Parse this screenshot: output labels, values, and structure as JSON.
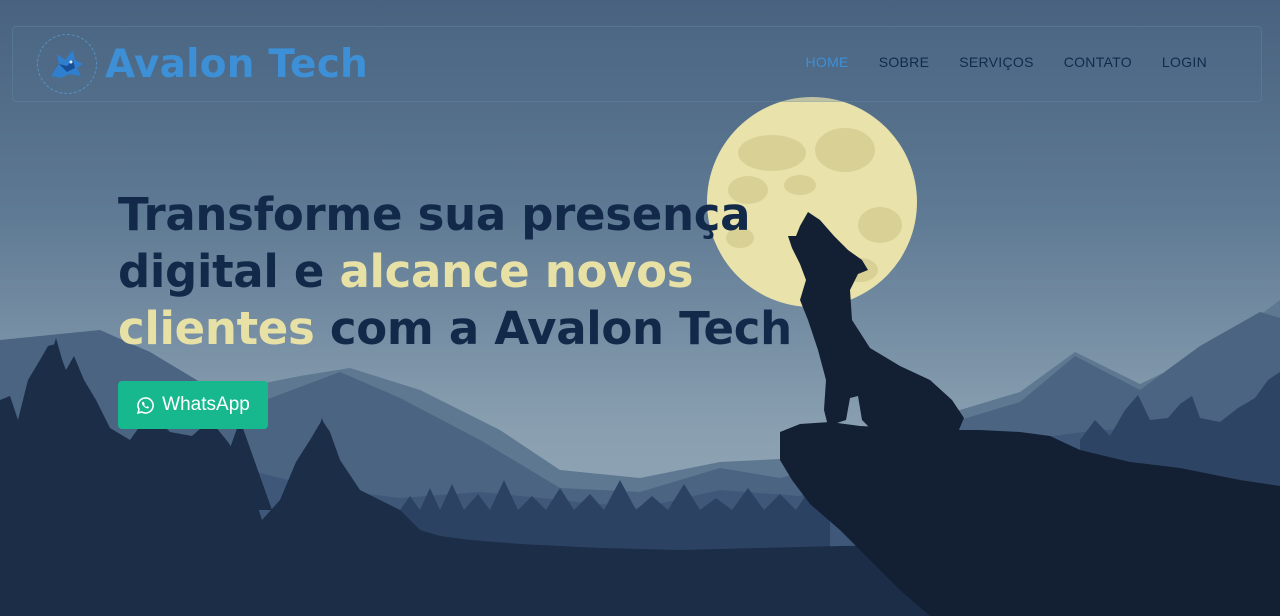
{
  "brand": {
    "name": "Avalon Tech",
    "logo_icon": "wolf-logo-icon"
  },
  "nav": {
    "items": [
      {
        "label": "HOME",
        "active": true
      },
      {
        "label": "SOBRE",
        "active": false
      },
      {
        "label": "SERVIÇOS",
        "active": false
      },
      {
        "label": "CONTATO",
        "active": false
      },
      {
        "label": "LOGIN",
        "active": false
      }
    ]
  },
  "hero": {
    "headline": {
      "part1": "Transforme sua presença digital e ",
      "highlight1": "alcance novos clientes",
      "part2": " com a Avalon Tech"
    },
    "cta": {
      "label": "WhatsApp",
      "icon": "whatsapp-icon"
    },
    "background": "night landscape with full moon, mountains, pine trees and howling wolf silhouette"
  },
  "colors": {
    "brand": "#3d8fd6",
    "headline": "#12294a",
    "highlight": "#e8e1a6",
    "cta": "#18b88f",
    "moon": "#e9e2ab"
  }
}
